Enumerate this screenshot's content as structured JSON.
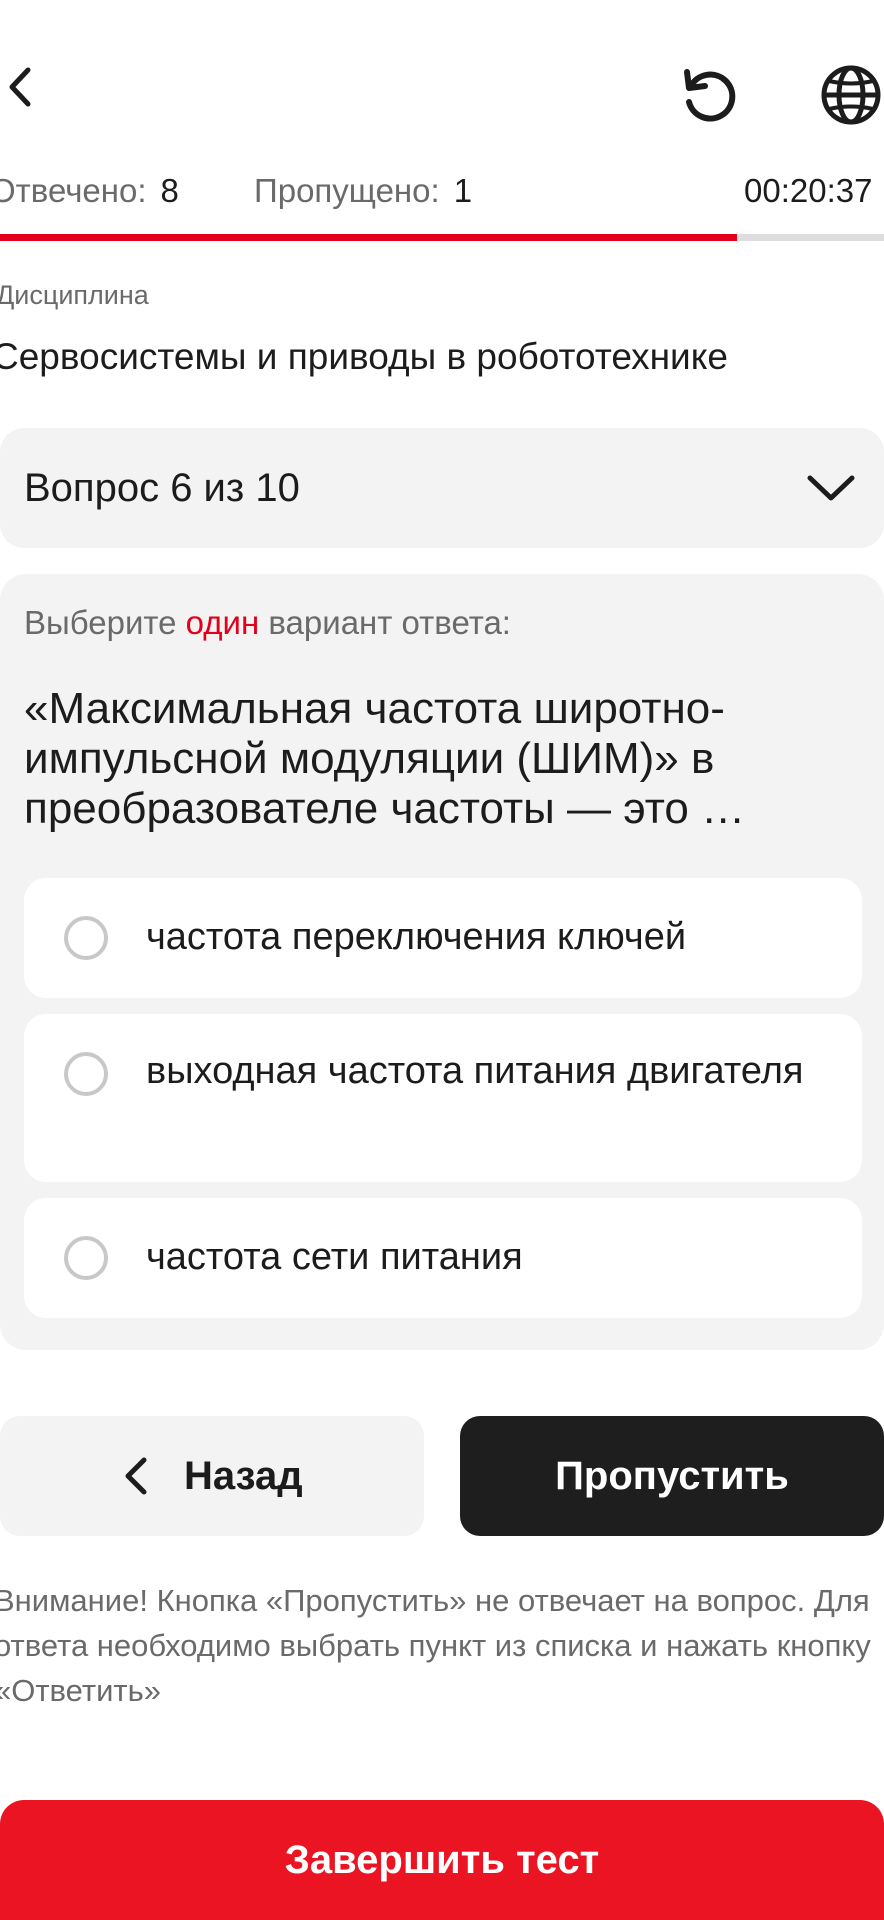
{
  "header": {
    "back_icon": "chevron-left-icon",
    "reload_icon": "reload-icon",
    "language_icon": "globe-icon"
  },
  "status": {
    "answered_label": "Отвечено:",
    "answered_value": "8",
    "skipped_label": "Пропущено:",
    "skipped_value": "1",
    "timer": "00:20:37"
  },
  "progress": {
    "fraction": 0.834,
    "fill_color": "#e3001b",
    "track_color": "#dddddd"
  },
  "discipline": {
    "label": "Дисциплина",
    "name": "Сервосистемы и приводы в робототехнике"
  },
  "question_selector": {
    "label": "Вопрос 6 из 10",
    "icon": "chevron-down-icon"
  },
  "question": {
    "instruction_before": "Выберите ",
    "instruction_accent": "один",
    "instruction_after": " вариант ответа:",
    "text": "«Максимальная частота широтно-импульсной модуляции (ШИМ)» в преобразователе частоты — это …",
    "options": [
      {
        "label": "частота переключения ключей"
      },
      {
        "label": "выходная частота питания двигателя"
      },
      {
        "label": "частота сети питания"
      }
    ]
  },
  "buttons": {
    "back_label": "Назад",
    "skip_label": "Пропустить",
    "finish_label": "Завершить тест"
  },
  "warning": "Внимание! Кнопка «Пропустить» не отвечает на вопрос. Для ответа необходимо выбрать пункт из списка и нажать кнопку «Ответить»",
  "colors": {
    "accent": "#e3001b",
    "finish_button": "#ea1422",
    "dark_button": "#1e1e1e"
  }
}
